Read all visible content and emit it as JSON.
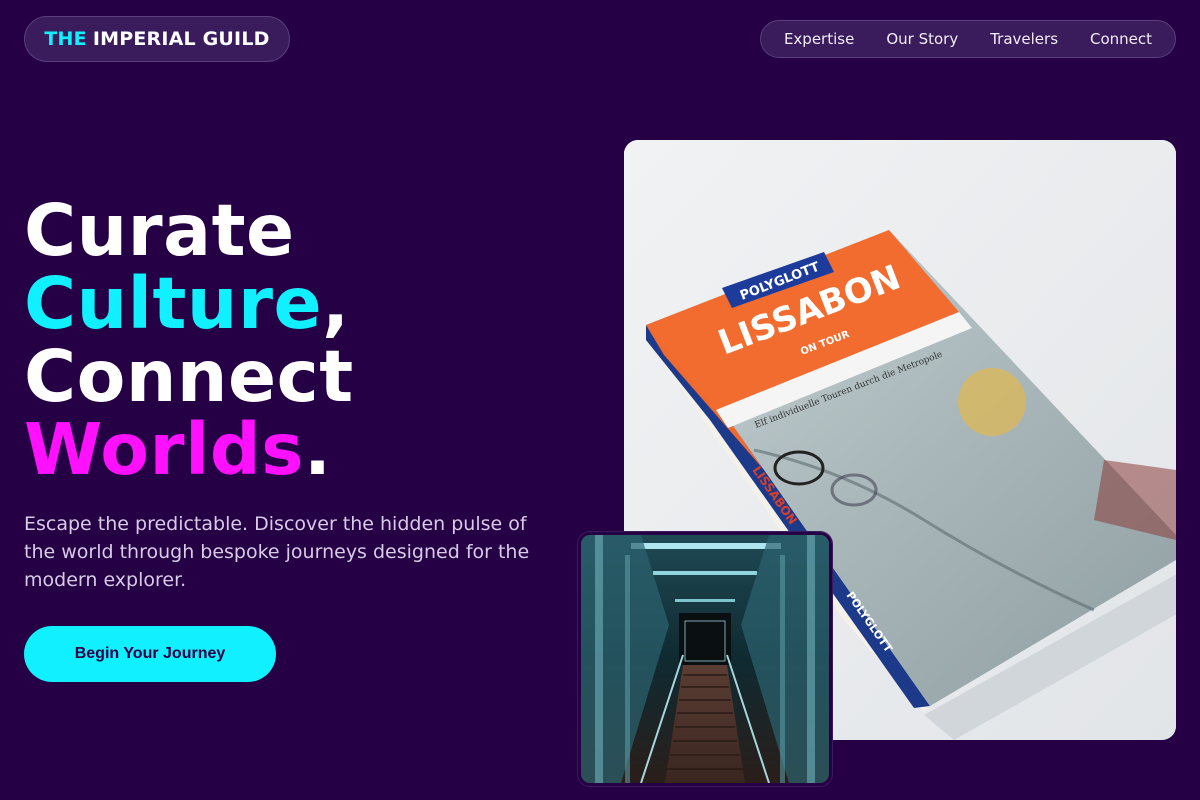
{
  "brand": {
    "accent_word": "THE",
    "rest": "IMPERIAL GUILD",
    "accent_color": "#10f0ff"
  },
  "nav": {
    "items": [
      "Expertise",
      "Our Story",
      "Travelers",
      "Connect"
    ]
  },
  "hero": {
    "line1": "Curate",
    "line2_word": "Culture",
    "line2_punct": ",",
    "line3": "Connect",
    "line4_word": "Worlds",
    "line4_punct": ".",
    "subtext": "Escape the predictable. Discover the hidden pulse of the world through bespoke journeys designed for the modern explorer.",
    "cta_label": "Begin Your Journey"
  },
  "images": {
    "book": {
      "icon": "guidebook-photo",
      "publisher": "POLYGLOTT",
      "title": "LISSABON",
      "subtitle": "ON TOUR",
      "tagline": "Elf individuelle Touren durch die Metropole",
      "spine_title": "LISSABON",
      "spine_publisher": "POLYGLOTT"
    },
    "station": {
      "icon": "covered-stairway-photo"
    }
  },
  "colors": {
    "background": "#250045",
    "cyan": "#10f0ff",
    "magenta": "#ff10ff",
    "pill": "#3a1c5c"
  }
}
